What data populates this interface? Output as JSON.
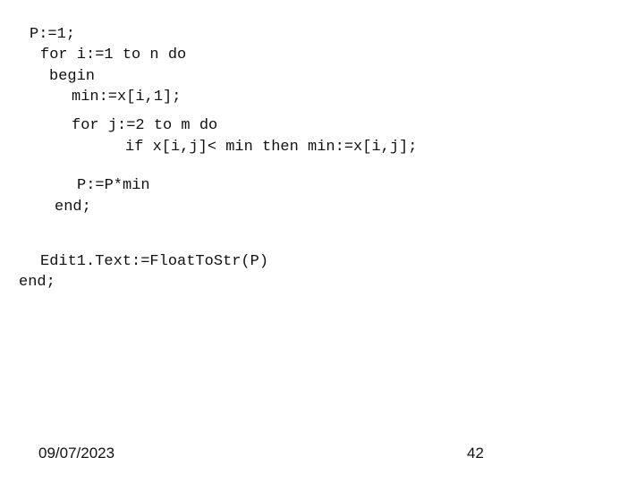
{
  "code_lines": [
    "P:=1;",
    "for i:=1 to n do",
    "begin",
    "min:=x[i,1];",
    "for j:=2 to m do",
    "if x[i,j]< min then min:=x[i,j];",
    "P:=P*min",
    "end;",
    "Edit1.Text:=FloatToStr(P)",
    "end;"
  ],
  "footer": {
    "date": "09/07/2023",
    "slide_number": "42"
  }
}
